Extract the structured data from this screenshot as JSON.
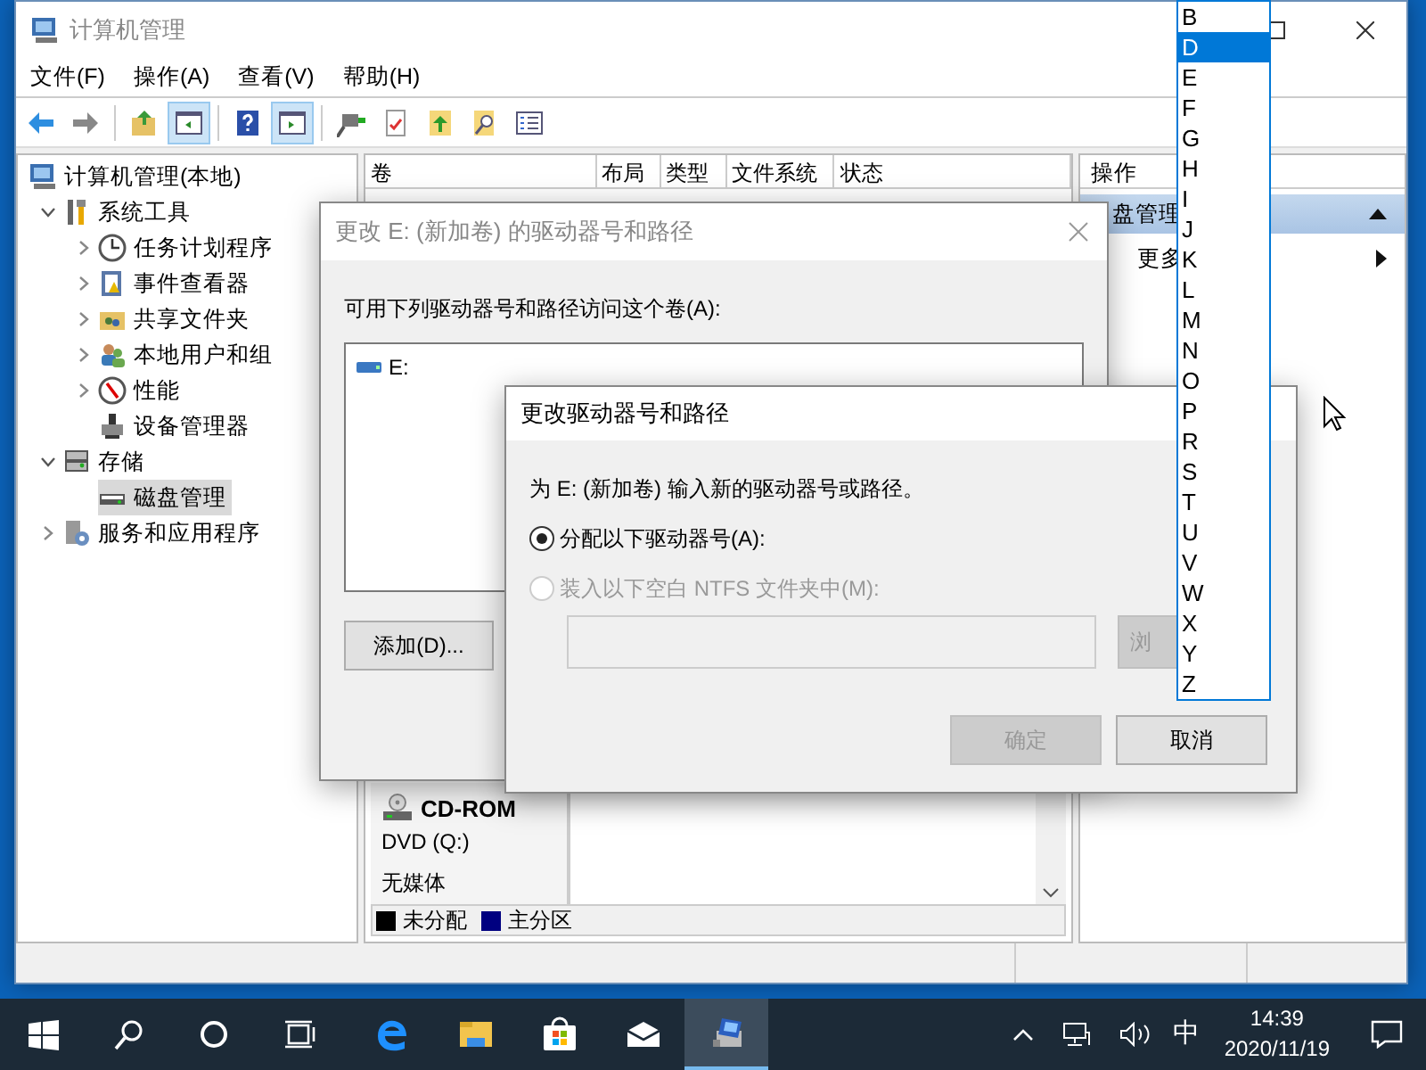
{
  "window": {
    "title": "计算机管理"
  },
  "menu": [
    "文件(F)",
    "操作(A)",
    "查看(V)",
    "帮助(H)"
  ],
  "toolbar": [
    {
      "pressed": false
    },
    {
      "pressed": false
    },
    {
      "pressed": false
    },
    {
      "pressed": true
    },
    {
      "pressed": false
    },
    {
      "pressed": true
    },
    {
      "pressed": false
    },
    {
      "pressed": false
    },
    {
      "pressed": false
    },
    {
      "pressed": false
    },
    {
      "pressed": false
    }
  ],
  "tree": [
    {
      "label": "计算机管理(本地)",
      "selected": false,
      "children": [
        {
          "label": "系统工具",
          "selected": false,
          "expanded": true,
          "children": [
            {
              "label": "任务计划程序",
              "selected": false,
              "expanded": false
            },
            {
              "label": "事件查看器",
              "selected": false,
              "expanded": false
            },
            {
              "label": "共享文件夹",
              "selected": false,
              "expanded": false
            },
            {
              "label": "本地用户和组",
              "selected": false,
              "expanded": false
            },
            {
              "label": "性能",
              "selected": false,
              "expanded": false
            },
            {
              "label": "设备管理器",
              "selected": false
            }
          ]
        },
        {
          "label": "存储",
          "selected": false,
          "expanded": true,
          "children": [
            {
              "label": "磁盘管理",
              "selected": true
            }
          ]
        },
        {
          "label": "服务和应用程序",
          "selected": false,
          "expanded": false
        }
      ]
    }
  ],
  "volume_table": {
    "columns": [
      "卷",
      "布局",
      "类型",
      "文件系统",
      "状态"
    ]
  },
  "disk_view": {
    "disk": {
      "name": "CD-ROM",
      "type": "DVD (Q:)",
      "media": "无媒体"
    },
    "legend": [
      {
        "label": "未分配",
        "color": "#000000"
      },
      {
        "label": "主分区",
        "color": "#000080"
      }
    ]
  },
  "actions": {
    "title": "操作",
    "items": [
      {
        "label": "盘管理",
        "kind": "group",
        "selected": true
      },
      {
        "label": "更多",
        "kind": "submenu",
        "selected": false
      }
    ]
  },
  "dialog_paths": {
    "title": "更改 E: (新加卷) 的驱动器号和路径",
    "prompt": "可用下列驱动器号和路径访问这个卷(A):",
    "entries": [
      "E:"
    ],
    "buttons": [
      "添加(D)..."
    ]
  },
  "dialog_change": {
    "title": "更改驱动器号和路径",
    "prompt": "为 E: (新加卷) 输入新的驱动器号或路径。",
    "options": [
      {
        "label": "分配以下驱动器号(A):",
        "checked": true,
        "disabled": false
      },
      {
        "label": "装入以下空白 NTFS 文件夹中(M):",
        "checked": false,
        "disabled": true
      }
    ],
    "folder_field": {
      "disabled": true
    },
    "browse_button": {
      "label": "浏",
      "disabled": true
    },
    "buttons": [
      {
        "label": "确定",
        "disabled": true
      },
      {
        "label": "取消",
        "disabled": false
      }
    ]
  },
  "drive_letter_list": [
    {
      "label": "B",
      "selected": false
    },
    {
      "label": "D",
      "selected": true
    },
    {
      "label": "E",
      "selected": false
    },
    {
      "label": "F",
      "selected": false
    },
    {
      "label": "G",
      "selected": false
    },
    {
      "label": "H",
      "selected": false
    },
    {
      "label": "I",
      "selected": false
    },
    {
      "label": "J",
      "selected": false
    },
    {
      "label": "K",
      "selected": false
    },
    {
      "label": "L",
      "selected": false
    },
    {
      "label": "M",
      "selected": false
    },
    {
      "label": "N",
      "selected": false
    },
    {
      "label": "O",
      "selected": false
    },
    {
      "label": "P",
      "selected": false
    },
    {
      "label": "R",
      "selected": false
    },
    {
      "label": "S",
      "selected": false
    },
    {
      "label": "T",
      "selected": false
    },
    {
      "label": "U",
      "selected": false
    },
    {
      "label": "V",
      "selected": false
    },
    {
      "label": "W",
      "selected": false
    },
    {
      "label": "X",
      "selected": false
    },
    {
      "label": "Y",
      "selected": false
    },
    {
      "label": "Z",
      "selected": false
    }
  ],
  "taskbar": {
    "apps": [
      {
        "selected": false
      },
      {
        "selected": false
      },
      {
        "selected": false
      },
      {
        "selected": false
      },
      {
        "selected": true
      }
    ],
    "input_method": "中",
    "time": "14:39",
    "date": "2020/11/19"
  }
}
